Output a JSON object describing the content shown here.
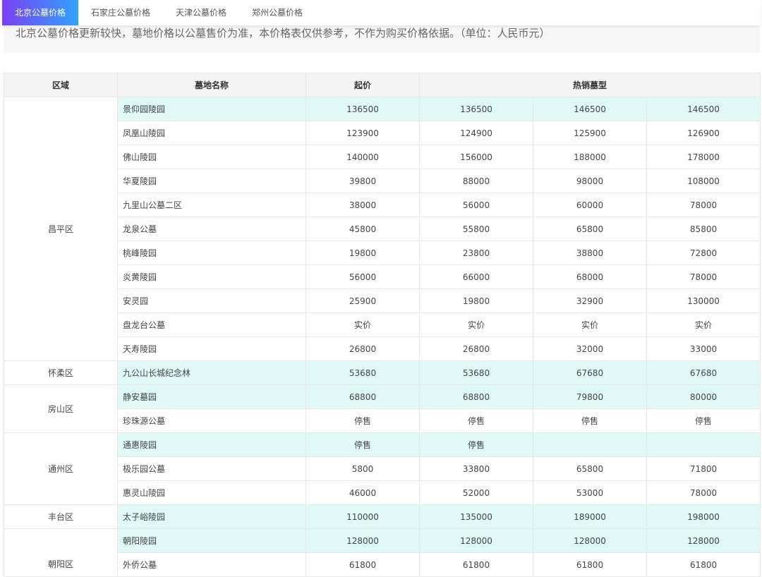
{
  "tabs": [
    "北京公墓价格",
    "石家庄公墓价格",
    "天津公墓价格",
    "郑州公墓价格"
  ],
  "notice": "北京公墓价格更新较快，墓地价格以公墓售价为准，本价格表仅供参考，不作为购买价格依据。（单位：人民币元）",
  "headers": {
    "region": "区域",
    "name": "墓地名称",
    "start": "起价",
    "hot": "热销墓型"
  },
  "regions": [
    {
      "name": "昌平区",
      "rows": [
        [
          "景仰园陵园",
          "136500",
          "136500",
          "146500",
          "146500"
        ],
        [
          "凤凰山陵园",
          "123900",
          "124900",
          "125900",
          "126900"
        ],
        [
          "佛山陵园",
          "140000",
          "156000",
          "188000",
          "178000"
        ],
        [
          "华夏陵园",
          "39800",
          "88000",
          "98000",
          "108000"
        ],
        [
          "九里山公墓二区",
          "38000",
          "56000",
          "60000",
          "78000"
        ],
        [
          "龙泉公墓",
          "45800",
          "55800",
          "65800",
          "85800"
        ],
        [
          "桃峰陵园",
          "19800",
          "23800",
          "38800",
          "72800"
        ],
        [
          "炎黄陵园",
          "56000",
          "66000",
          "68000",
          "78000"
        ],
        [
          "安灵园",
          "25900",
          "19800",
          "32900",
          "130000"
        ],
        [
          "盘龙台公墓",
          "实价",
          "实价",
          "实价",
          "实价"
        ],
        [
          "天寿陵园",
          "26800",
          "26800",
          "32000",
          "33000"
        ]
      ]
    },
    {
      "name": "怀柔区",
      "rows": [
        [
          "九公山长城纪念林",
          "53680",
          "53680",
          "67680",
          "67680"
        ]
      ]
    },
    {
      "name": "房山区",
      "rows": [
        [
          "静安墓园",
          "68800",
          "68800",
          "79800",
          "80000"
        ],
        [
          "珍珠源公墓",
          "停售",
          "停售",
          "停售",
          "停售"
        ]
      ]
    },
    {
      "name": "通州区",
      "rows": [
        [
          "通惠陵园",
          "停售",
          "停售",
          "",
          ""
        ],
        [
          "极乐园公墓",
          "5800",
          "33800",
          "65800",
          "71800"
        ],
        [
          "惠灵山陵园",
          "46000",
          "52000",
          "53000",
          "78000"
        ]
      ]
    },
    {
      "name": "丰台区",
      "rows": [
        [
          "太子峪陵园",
          "110000",
          "135000",
          "189000",
          "198000"
        ]
      ]
    },
    {
      "name": "朝阳区",
      "rows": [
        [
          "朝阳陵园",
          "128000",
          "128000",
          "128000",
          "128000"
        ],
        [
          "外侨公墓",
          "61800",
          "61800",
          "61800",
          "61800"
        ]
      ]
    }
  ]
}
